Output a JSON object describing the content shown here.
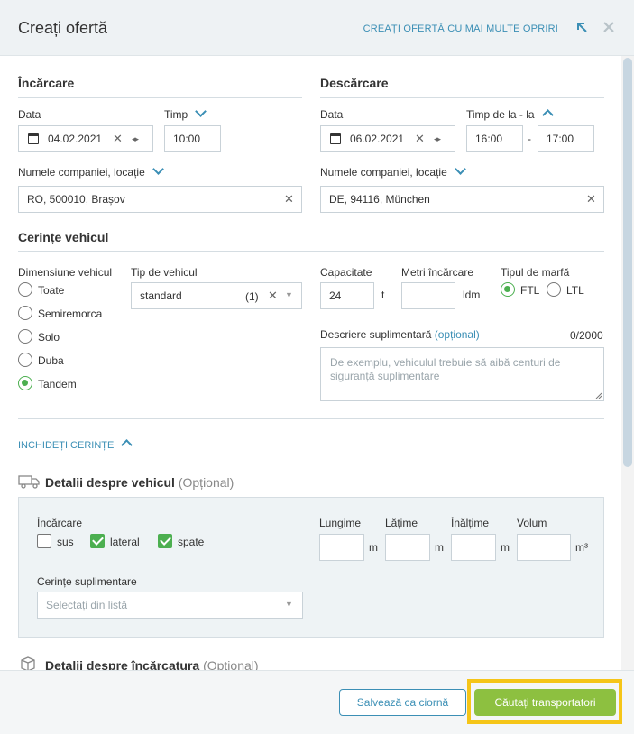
{
  "header": {
    "title": "Creați ofertă",
    "multi_stop_link": "CREAȚI OFERTĂ CU MAI MULTE OPRIRI"
  },
  "loading": {
    "title": "Încărcare",
    "date_label": "Data",
    "date_value": "04.02.2021",
    "time_label": "Timp",
    "time_value": "10:00",
    "company_label": "Numele companiei, locație",
    "company_value": "RO, 500010, Brașov"
  },
  "unloading": {
    "title": "Descărcare",
    "date_label": "Data",
    "date_value": "06.02.2021",
    "time_label": "Timp de la - la",
    "time_from": "16:00",
    "time_separator": "-",
    "time_to": "17:00",
    "company_label": "Numele companiei, locație",
    "company_value": "DE, 94116, München"
  },
  "vehicle_requirements": {
    "title": "Cerințe vehicul",
    "size_label": "Dimensiune vehicul",
    "size_options": [
      "Toate",
      "Semiremorca",
      "Solo",
      "Duba",
      "Tandem"
    ],
    "size_selected": "Tandem",
    "type_label": "Tip de vehicul",
    "type_value": "standard",
    "type_count": "(1)",
    "capacity_label": "Capacitate",
    "capacity_value": "24",
    "capacity_unit": "t",
    "ldm_label": "Metri încărcare",
    "ldm_value": "",
    "ldm_unit": "ldm",
    "freight_label": "Tipul de marfă",
    "freight_options": [
      "FTL",
      "LTL"
    ],
    "freight_selected": "FTL",
    "description_label": "Descriere suplimentară",
    "description_optional": "(opțional)",
    "description_counter": "0/2000",
    "description_placeholder": "De exemplu, vehiculul trebuie să aibă centuri de siguranță suplimentare"
  },
  "toggle_requirements": "INCHIDEȚI CERINȚE",
  "vehicle_details": {
    "title": "Detalii despre vehicul",
    "optional": "(Opțional)",
    "loading_label": "Încărcare",
    "loading_options": [
      {
        "label": "sus",
        "checked": false
      },
      {
        "label": "lateral",
        "checked": true
      },
      {
        "label": "spate",
        "checked": true
      }
    ],
    "length_label": "Lungime",
    "width_label": "Lățime",
    "height_label": "Înălțime",
    "volume_label": "Volum",
    "unit_m": "m",
    "unit_m3": "m³",
    "extra_label": "Cerințe suplimentare",
    "extra_placeholder": "Selectați din listă"
  },
  "cargo_details": {
    "title": "Detalii despre încărcatura",
    "optional": "(Opțional)"
  },
  "footer": {
    "save_draft": "Salvează ca ciornă",
    "search_carriers": "Căutați transportatori"
  },
  "colors": {
    "accent": "#3b8fb5",
    "success": "#4caf50",
    "primary_button": "#8dc040",
    "highlight": "#f5c518"
  }
}
